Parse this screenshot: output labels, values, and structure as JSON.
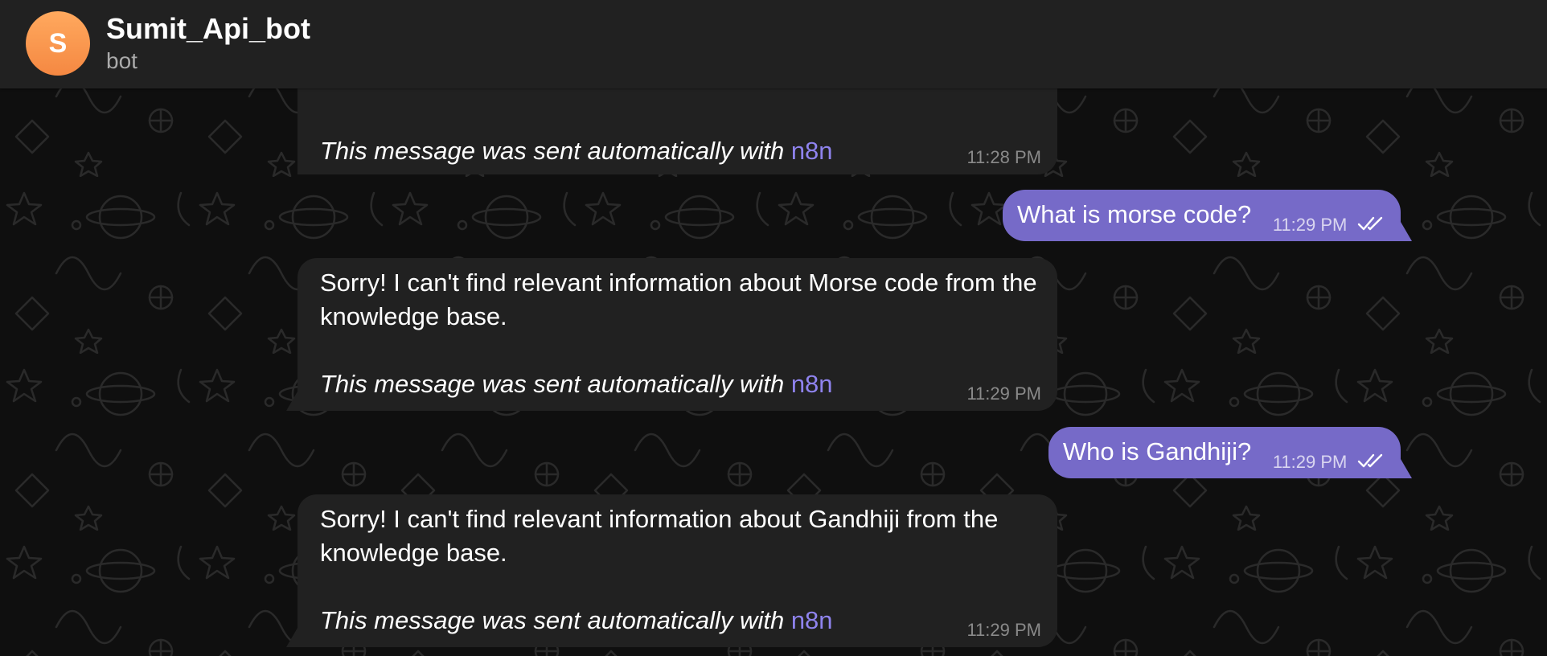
{
  "chat": {
    "avatar_letter": "S",
    "name": "Sumit_Api_bot",
    "status": "bot"
  },
  "theme": {
    "header_bg": "#212121",
    "incoming_bubble": "#212121",
    "outgoing_bubble": "#766ac8",
    "link_color": "#8f83ee",
    "avatar_gradient": [
      "#ffa95e",
      "#f58842"
    ]
  },
  "messages": [
    {
      "direction": "incoming",
      "text_partial": "",
      "signature": "This message was sent automatically with",
      "signature_link": "n8n",
      "time": "11:28 PM"
    },
    {
      "direction": "outgoing",
      "text": "What is morse code?",
      "time": "11:29 PM",
      "status_icon": "double-check-icon"
    },
    {
      "direction": "incoming",
      "text": "Sorry! I can't find relevant information about Morse code from the knowledge base.",
      "signature": "This message was sent automatically with",
      "signature_link": "n8n",
      "time": "11:29 PM"
    },
    {
      "direction": "outgoing",
      "text": "Who is Gandhiji?",
      "time": "11:29 PM",
      "status_icon": "double-check-icon"
    },
    {
      "direction": "incoming",
      "text": "Sorry! I can't find relevant information about Gandhiji from the knowledge base.",
      "signature": "This message was sent automatically with",
      "signature_link": "n8n",
      "time": "11:29 PM"
    }
  ]
}
